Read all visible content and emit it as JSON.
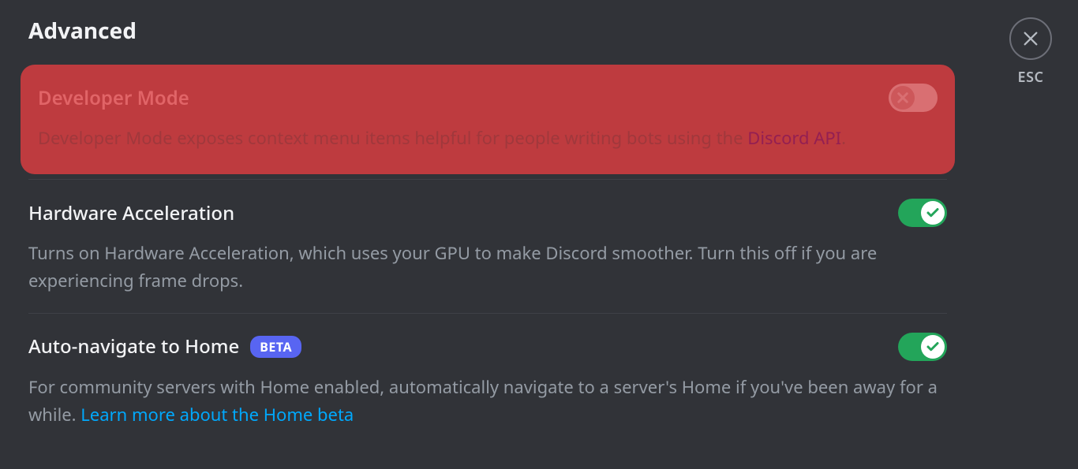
{
  "page_title": "Advanced",
  "close_label": "ESC",
  "settings": {
    "developer_mode": {
      "title": "Developer Mode",
      "desc_before_link": "Developer Mode exposes context menu items helpful for people writing bots using the ",
      "link_text": "Discord API",
      "desc_after_link": ".",
      "enabled": false
    },
    "hardware_accel": {
      "title": "Hardware Acceleration",
      "desc": "Turns on Hardware Acceleration, which uses your GPU to make Discord smoother. Turn this off if you are experiencing frame drops.",
      "enabled": true
    },
    "auto_navigate": {
      "title": "Auto-navigate to Home",
      "badge": "BETA",
      "desc_before_link": "For community servers with Home enabled, automatically navigate to a server's Home if you've been away for a while. ",
      "link_text": "Learn more about the Home beta",
      "enabled": true
    }
  }
}
